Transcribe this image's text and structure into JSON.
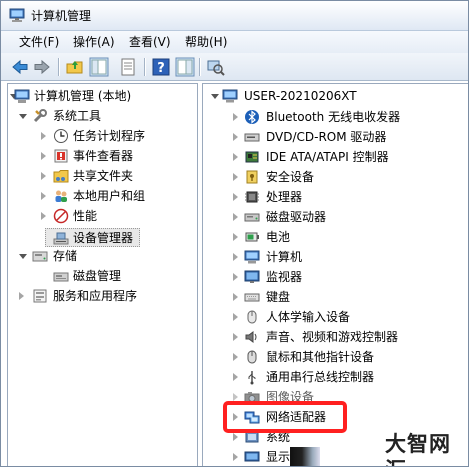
{
  "window": {
    "title": "计算机管理"
  },
  "menu": [
    {
      "label": "文件(F)"
    },
    {
      "label": "操作(A)"
    },
    {
      "label": "查看(V)"
    },
    {
      "label": "帮助(H)"
    }
  ],
  "toolbar": {
    "icons": [
      "back-icon",
      "forward-icon",
      "up-folder-icon",
      "show-hide-tree-icon",
      "properties-icon",
      "help-icon",
      "action-pane-icon",
      "scan-hardware-icon"
    ]
  },
  "left_tree": {
    "root": "计算机管理 (本地)",
    "system_tools": "系统工具",
    "task_scheduler": "任务计划程序",
    "event_viewer": "事件查看器",
    "shared_folders": "共享文件夹",
    "local_users": "本地用户和组",
    "performance": "性能",
    "device_manager": "设备管理器",
    "storage": "存储",
    "disk_management": "磁盘管理",
    "services_apps": "服务和应用程序"
  },
  "device_tree": {
    "computer": "USER-20210206XT",
    "categories": [
      {
        "label": "Bluetooth 无线电收发器",
        "icon": "bluetooth-icon"
      },
      {
        "label": "DVD/CD-ROM 驱动器",
        "icon": "dvd-drive-icon"
      },
      {
        "label": "IDE ATA/ATAPI 控制器",
        "icon": "ide-controller-icon"
      },
      {
        "label": "安全设备",
        "icon": "security-device-icon"
      },
      {
        "label": "处理器",
        "icon": "processor-icon"
      },
      {
        "label": "磁盘驱动器",
        "icon": "disk-drive-icon"
      },
      {
        "label": "电池",
        "icon": "battery-icon"
      },
      {
        "label": "计算机",
        "icon": "computer-icon"
      },
      {
        "label": "监视器",
        "icon": "monitor-icon"
      },
      {
        "label": "键盘",
        "icon": "keyboard-icon"
      },
      {
        "label": "人体学输入设备",
        "icon": "hid-icon"
      },
      {
        "label": "声音、视频和游戏控制器",
        "icon": "sound-icon"
      },
      {
        "label": "鼠标和其他指针设备",
        "icon": "mouse-icon"
      },
      {
        "label": "通用串行总线控制器",
        "icon": "usb-icon"
      },
      {
        "label": "图像设备",
        "icon": "imaging-device-icon"
      },
      {
        "label": "网络适配器",
        "icon": "network-adapter-icon"
      },
      {
        "label": "系统",
        "icon": "system-device-icon"
      },
      {
        "label": "显示",
        "icon": "display-adapter-icon"
      }
    ]
  },
  "watermark": "大智网汇",
  "colors": {
    "highlight": "#ff2020",
    "selection": "#e8e8e8"
  }
}
